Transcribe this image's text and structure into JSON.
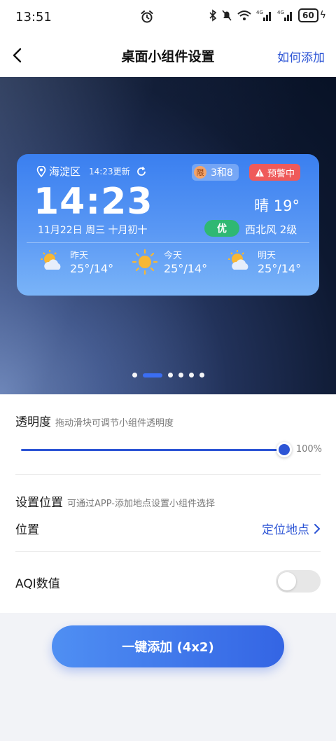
{
  "status_bar": {
    "time": "13:51",
    "network": "4G",
    "battery": "60"
  },
  "header": {
    "title": "桌面小组件设置",
    "help_link": "如何添加"
  },
  "widget": {
    "location": "海淀区",
    "update_text": "14:23更新",
    "limit_badge": "限",
    "limit_numbers": "3和8",
    "warning": "预警中",
    "time": "14:23",
    "date": "11月22日 周三 十月初十",
    "weather": "晴 19°",
    "aqi": "优",
    "wind": "西北风 2级",
    "days": [
      {
        "label": "昨天",
        "temp": "25°/14°",
        "icon": "partly-cloudy-icon"
      },
      {
        "label": "今天",
        "temp": "25°/14°",
        "icon": "sun-icon"
      },
      {
        "label": "明天",
        "temp": "25°/14°",
        "icon": "partly-cloudy-icon"
      }
    ]
  },
  "carousel": {
    "count": 6,
    "active_index": 1
  },
  "transparency": {
    "title": "透明度",
    "subtitle": "拖动滑块可调节小组件透明度",
    "value": "100%",
    "level": 1.0
  },
  "location_setting": {
    "title": "设置位置",
    "subtitle": "可通过APP-添加地点设置小组件选择",
    "row_label": "位置",
    "link": "定位地点"
  },
  "aqi_setting": {
    "label": "AQI数值",
    "enabled": false
  },
  "add_button": "一键添加 (4x2)",
  "colors": {
    "accent": "#2d55d5",
    "aqi_good": "#2fb873",
    "warning": "#ef5a5a"
  }
}
